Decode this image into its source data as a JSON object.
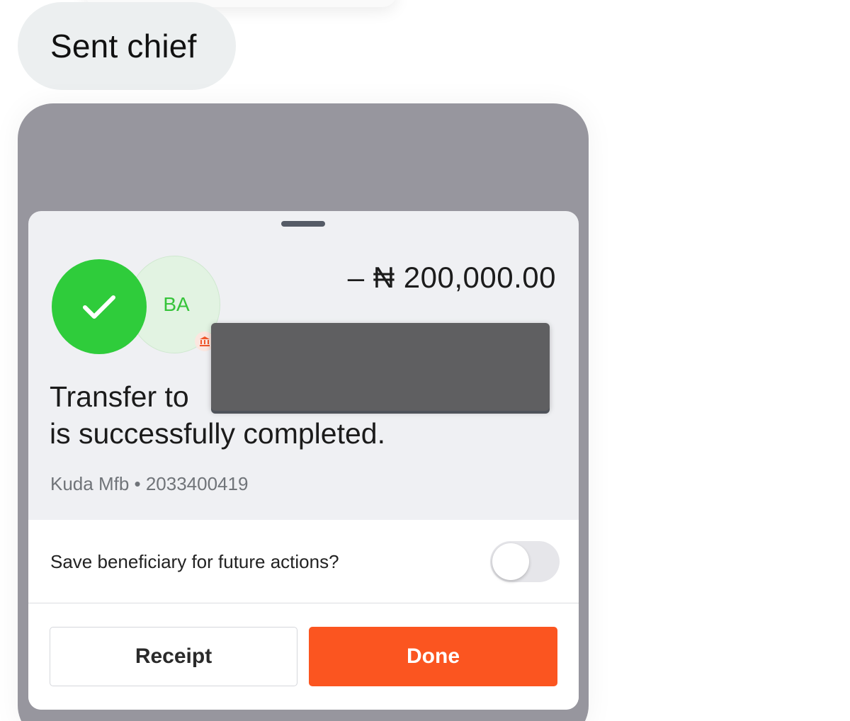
{
  "chat": {
    "message": "Sent chief"
  },
  "transfer": {
    "amount": "– ₦ 200,000.00",
    "recipient_initials": "BA",
    "message_line1": "Transfer to",
    "message_line2": "is successfully completed.",
    "bank_info": "Kuda Mfb • 2033400419"
  },
  "save_beneficiary": {
    "label": "Save beneficiary for future actions?",
    "enabled": false
  },
  "buttons": {
    "receipt": "Receipt",
    "done": "Done"
  },
  "colors": {
    "success_green": "#2fcc3b",
    "initials_green": "#36c43a",
    "done_orange": "#fb5520",
    "overlay_gray": "#97969e",
    "redaction": "#5f5f61"
  },
  "icons": {
    "success": "checkmark-icon",
    "bank": "bank-icon"
  }
}
